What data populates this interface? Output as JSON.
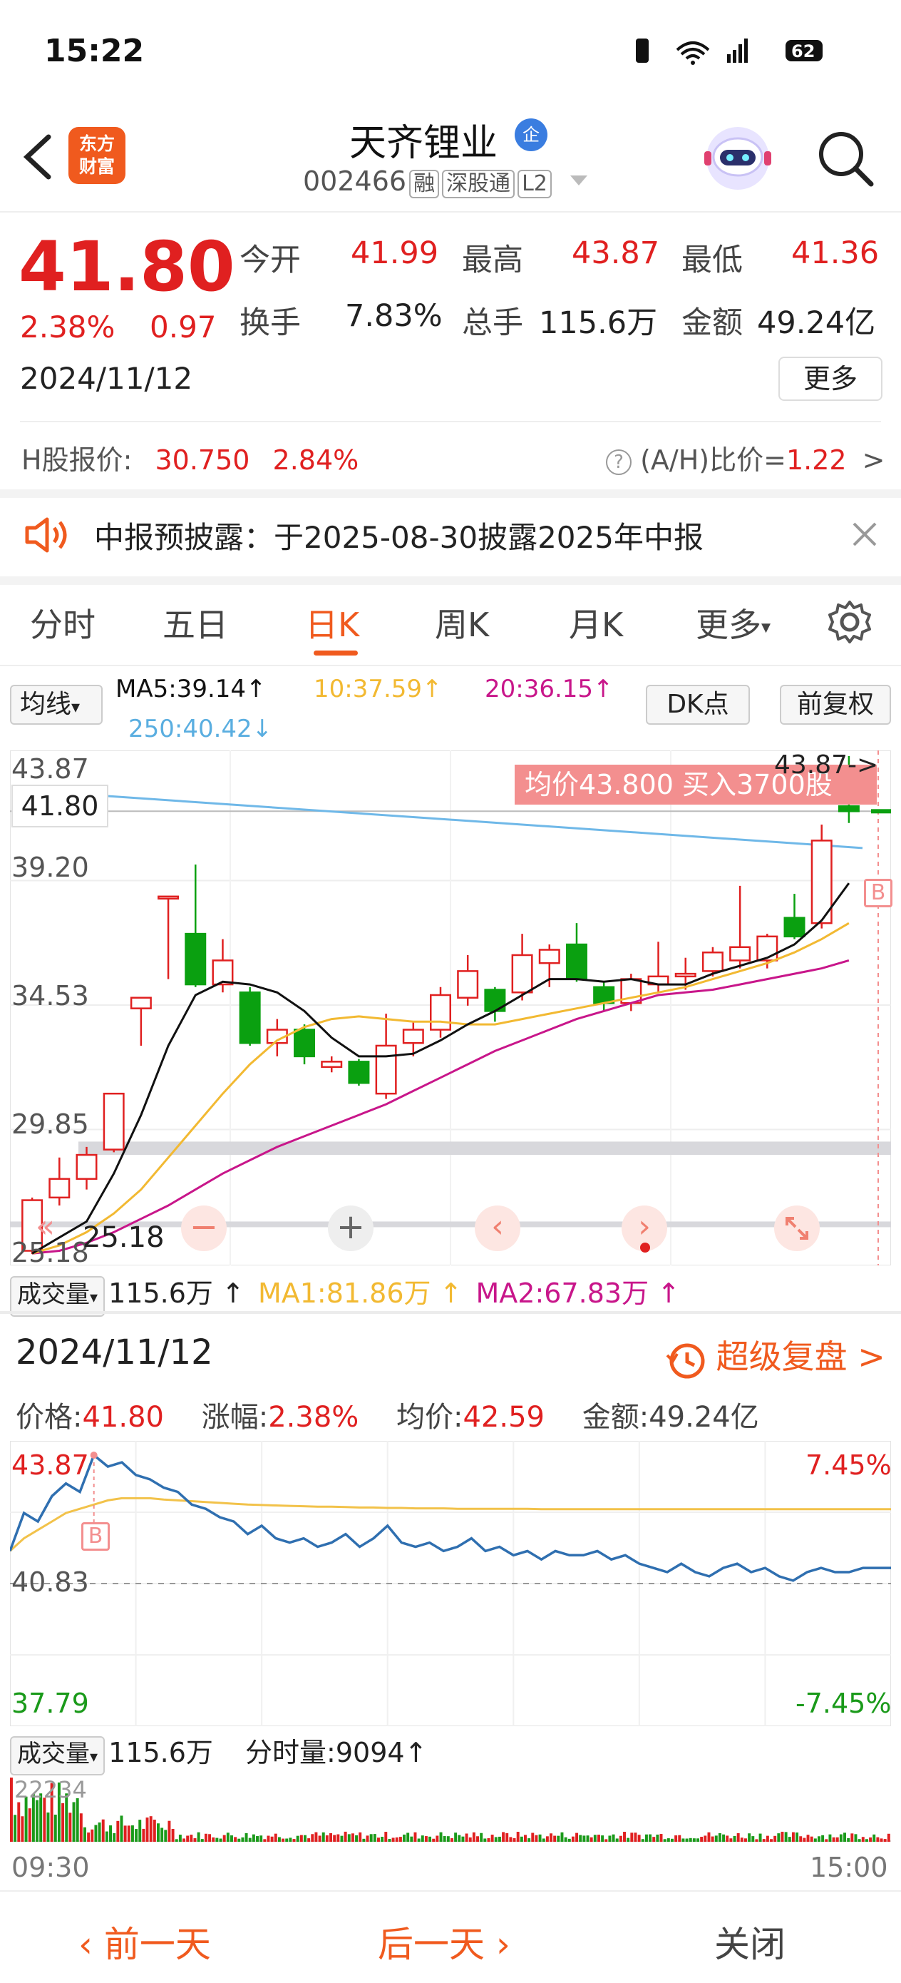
{
  "status_bar": {
    "time": "15:22",
    "battery": "62"
  },
  "header": {
    "app_logo": "东方\n财富",
    "stock_name": "天齐锂业",
    "name_badge": "企",
    "stock_code": "002466",
    "tags": [
      "融",
      "深股通",
      "L2"
    ]
  },
  "quote": {
    "price": "41.80",
    "change_pct": "2.38%",
    "change": "0.97",
    "date": "2024/11/12",
    "fields": [
      {
        "label": "今开",
        "value": "41.99",
        "color": "#e02020"
      },
      {
        "label": "最高",
        "value": "43.87",
        "color": "#e02020"
      },
      {
        "label": "最低",
        "value": "41.36",
        "color": "#e02020"
      },
      {
        "label": "换手",
        "value": "7.83%",
        "color": "#222222"
      },
      {
        "label": "总手",
        "value": "115.6万",
        "color": "#222222"
      },
      {
        "label": "金额",
        "value": "49.24亿",
        "color": "#222222"
      }
    ],
    "more_label": "更多",
    "h_share_label": "H股报价:",
    "h_share_price": "30.750",
    "h_share_pct": "2.84%",
    "ah_label": "(A/H)比价=",
    "ah_value": "1.22",
    "ah_arrow": ">"
  },
  "notice": {
    "text": "中报预披露：于2025-08-30披露2025年中报"
  },
  "tabs": [
    {
      "label": "分时",
      "active": false
    },
    {
      "label": "五日",
      "active": false
    },
    {
      "label": "日K",
      "active": true
    },
    {
      "label": "周K",
      "active": false
    },
    {
      "label": "月K",
      "active": false
    },
    {
      "label": "更多",
      "active": false
    }
  ],
  "ma_bar": {
    "select_label": "均线",
    "ma5": "MA5:39.14↑",
    "ma10": "10:37.59↑",
    "ma20": "20:36.15↑",
    "ma250": "250:40.42↓",
    "dk_label": "DK点",
    "fq_label": "前复权"
  },
  "kchart": {
    "y_labels": [
      "43.87",
      "39.20",
      "34.53",
      "29.85",
      "25.18"
    ],
    "current_price": "41.80",
    "avg_banner": "均价43.800  买入3700股",
    "high_marker": "43.87->",
    "low_marker": "25.18",
    "b_marker": "B",
    "colors": {
      "up": "#e02020",
      "down": "#0aa010",
      "ma5": "#111111",
      "ma10": "#f2b932",
      "ma20": "#c8168a",
      "ma250": "#6fb8e8"
    }
  },
  "chart_data": {
    "type": "candlestick",
    "ylim": [
      25.18,
      43.87
    ],
    "candles": [
      {
        "o": 25.3,
        "c": 27.2,
        "h": 27.3,
        "l": 25.18
      },
      {
        "o": 27.3,
        "c": 28.0,
        "h": 28.8,
        "l": 27.0
      },
      {
        "o": 28.0,
        "c": 28.9,
        "h": 29.2,
        "l": 27.6
      },
      {
        "o": 29.1,
        "c": 31.2,
        "h": 31.2,
        "l": 29.0
      },
      {
        "o": 34.4,
        "c": 34.8,
        "h": 34.8,
        "l": 33.0
      },
      {
        "o": 38.6,
        "c": 38.6,
        "h": 38.6,
        "l": 35.5
      },
      {
        "o": 37.2,
        "c": 35.3,
        "h": 39.8,
        "l": 35.2
      },
      {
        "o": 35.3,
        "c": 36.2,
        "h": 37.0,
        "l": 35.0
      },
      {
        "o": 35.0,
        "c": 33.1,
        "h": 35.2,
        "l": 33.0
      },
      {
        "o": 33.1,
        "c": 33.6,
        "h": 34.0,
        "l": 32.6
      },
      {
        "o": 33.6,
        "c": 32.6,
        "h": 33.8,
        "l": 32.3
      },
      {
        "o": 32.2,
        "c": 32.4,
        "h": 32.6,
        "l": 32.0
      },
      {
        "o": 32.4,
        "c": 31.6,
        "h": 32.5,
        "l": 31.5
      },
      {
        "o": 31.2,
        "c": 33.0,
        "h": 34.2,
        "l": 31.0
      },
      {
        "o": 33.1,
        "c": 33.6,
        "h": 33.9,
        "l": 32.6
      },
      {
        "o": 33.6,
        "c": 34.9,
        "h": 35.2,
        "l": 33.3
      },
      {
        "o": 34.8,
        "c": 35.8,
        "h": 36.4,
        "l": 34.5
      },
      {
        "o": 35.1,
        "c": 34.3,
        "h": 35.2,
        "l": 33.9
      },
      {
        "o": 35.0,
        "c": 36.4,
        "h": 37.2,
        "l": 34.7
      },
      {
        "o": 36.1,
        "c": 36.6,
        "h": 36.8,
        "l": 35.2
      },
      {
        "o": 36.8,
        "c": 35.5,
        "h": 37.6,
        "l": 35.4
      },
      {
        "o": 35.2,
        "c": 34.6,
        "h": 35.4,
        "l": 34.3
      },
      {
        "o": 34.6,
        "c": 35.5,
        "h": 35.7,
        "l": 34.3
      },
      {
        "o": 35.3,
        "c": 35.6,
        "h": 36.9,
        "l": 35.0
      },
      {
        "o": 35.6,
        "c": 35.7,
        "h": 36.3,
        "l": 35.1
      },
      {
        "o": 35.8,
        "c": 36.5,
        "h": 36.7,
        "l": 35.6
      },
      {
        "o": 36.2,
        "c": 36.7,
        "h": 39.0,
        "l": 35.9
      },
      {
        "o": 36.2,
        "c": 37.1,
        "h": 37.2,
        "l": 35.9
      },
      {
        "o": 37.8,
        "c": 37.1,
        "h": 38.7,
        "l": 37.0
      },
      {
        "o": 37.6,
        "c": 40.7,
        "h": 41.3,
        "l": 37.4
      },
      {
        "o": 41.99,
        "c": 41.8,
        "h": 43.87,
        "l": 41.36
      }
    ],
    "ma5": [
      25.2,
      25.8,
      26.4,
      28.2,
      30.4,
      33.0,
      34.9,
      35.4,
      35.3,
      35.0,
      34.3,
      33.3,
      32.6,
      32.6,
      32.7,
      33.2,
      33.8,
      34.3,
      34.9,
      35.5,
      35.5,
      35.4,
      35.5,
      35.3,
      35.3,
      35.7,
      36.0,
      36.3,
      36.8,
      37.7,
      39.1
    ],
    "ma10": [
      25.2,
      25.5,
      26.0,
      26.7,
      27.6,
      28.8,
      30.0,
      31.2,
      32.3,
      33.2,
      33.7,
      34.0,
      34.1,
      34.0,
      33.9,
      33.9,
      33.8,
      33.8,
      34.0,
      34.2,
      34.4,
      34.6,
      34.8,
      35.0,
      35.2,
      35.5,
      35.8,
      36.1,
      36.5,
      37.0,
      37.6
    ],
    "ma20": [
      25.2,
      25.3,
      25.6,
      26.0,
      26.5,
      27.0,
      27.6,
      28.2,
      28.7,
      29.2,
      29.6,
      30.0,
      30.4,
      30.8,
      31.3,
      31.8,
      32.3,
      32.8,
      33.2,
      33.6,
      34.0,
      34.3,
      34.6,
      34.9,
      35.0,
      35.1,
      35.3,
      35.5,
      35.7,
      35.9,
      36.2
    ],
    "ma250_start": 42.6,
    "ma250_end": 40.42,
    "volume": "115.6万",
    "volume_ma1": "81.86万",
    "volume_ma2": "67.83万"
  },
  "volume_bar": {
    "select_label": "成交量",
    "value": "115.6万 ↑",
    "ma1": "MA1:81.86万 ↑",
    "ma2": "MA2:67.83万 ↑"
  },
  "timeshare": {
    "date": "2024/11/12",
    "replay_label": "超级复盘",
    "replay_arrow": ">",
    "price_label": "价格:",
    "price": "41.80",
    "change_label": "涨幅:",
    "change": "2.38%",
    "avg_label": "均价:",
    "avg": "42.59",
    "amount_label": "金额:",
    "amount": "49.24亿",
    "y_top": "43.87",
    "y_mid": "40.83",
    "y_bot": "37.79",
    "pct_top": "7.45%",
    "pct_bot": "-7.45%",
    "vol_select": "成交量",
    "vol_value": "115.6万",
    "tick_vol": "分时量:9094↑",
    "vol_max": "22234",
    "time_start": "09:30",
    "time_end": "15:00",
    "b_marker": "B",
    "prices": [
      41.6,
      42.5,
      42.3,
      42.9,
      43.2,
      43.0,
      43.87,
      43.6,
      43.7,
      43.4,
      43.3,
      43.1,
      43.0,
      42.7,
      42.6,
      42.4,
      42.3,
      42.0,
      42.2,
      41.9,
      41.8,
      41.9,
      41.7,
      41.8,
      42.0,
      41.7,
      41.9,
      42.2,
      41.8,
      41.7,
      41.8,
      41.6,
      41.7,
      41.9,
      41.6,
      41.7,
      41.5,
      41.6,
      41.4,
      41.6,
      41.5,
      41.5,
      41.6,
      41.4,
      41.5,
      41.3,
      41.2,
      41.1,
      41.3,
      41.1,
      41.0,
      41.2,
      41.3,
      41.1,
      41.2,
      41.0,
      40.9,
      41.1,
      41.2,
      41.1,
      41.1,
      41.2,
      41.2,
      41.2
    ],
    "avg_prices": [
      41.6,
      41.9,
      42.1,
      42.3,
      42.5,
      42.6,
      42.7,
      42.8,
      42.85,
      42.85,
      42.85,
      42.82,
      42.8,
      42.78,
      42.76,
      42.74,
      42.72,
      42.7,
      42.69,
      42.68,
      42.67,
      42.66,
      42.65,
      42.65,
      42.64,
      42.63,
      42.63,
      42.62,
      42.62,
      42.61,
      42.61,
      42.61,
      42.6,
      42.6,
      42.6,
      42.6,
      42.6,
      42.6,
      42.59,
      42.59,
      42.59,
      42.59,
      42.59,
      42.59,
      42.59,
      42.59,
      42.59,
      42.59,
      42.59,
      42.59,
      42.59,
      42.59,
      42.59,
      42.59,
      42.59,
      42.59,
      42.59,
      42.59,
      42.59,
      42.59,
      42.59,
      42.59,
      42.59,
      42.59
    ]
  },
  "bottom_bar": {
    "prev_label": "前一天",
    "next_label": "后一天",
    "close_label": "关闭"
  }
}
